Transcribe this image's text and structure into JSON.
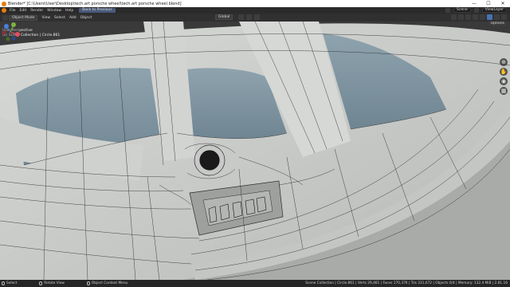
{
  "window": {
    "title": "Blender* [C:\\Users\\User\\Desktop\\tech.art porsche wheel\\tech.art porsche wheel.blend]",
    "controls": [
      "—",
      "☐",
      "✕"
    ]
  },
  "menubar": {
    "items": [
      "File",
      "Edit",
      "Render",
      "Window",
      "Help"
    ],
    "back_label": "Back to Previous",
    "scene_label": "Scene",
    "view_layer_label": "ViewLayer"
  },
  "header": {
    "mode": "Object Mode",
    "menus": [
      "View",
      "Select",
      "Add",
      "Object"
    ],
    "transform_orientation": "Global",
    "options_label": "Options"
  },
  "viewport": {
    "perspective_label": "User Perspective",
    "collection_label": "(4) Scene Collection | Circle.861",
    "gizmo_axes": [
      "X",
      "Y",
      "Z"
    ],
    "nav_icons": [
      "zoom-icon",
      "hand-icon",
      "camera-icon",
      "grid-icon"
    ],
    "colors": {
      "background": "#3a3a3a",
      "mesh": "#c9cbc9",
      "sky": "#7e95a0",
      "wire": "#2a2a2a"
    }
  },
  "statusbar": {
    "select_label": "Select",
    "rotate_label": "Rotate View",
    "context_label": "Object Context Menu",
    "stats": "Scene Collection | Circle.861 | Verts 29,461 | Faces 170,376 | Tris 331,672 | Objects 0/4 | Memory: 132.4 MiB | 2.81.16"
  }
}
